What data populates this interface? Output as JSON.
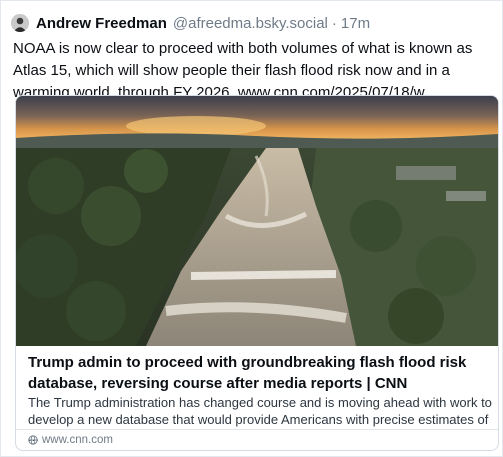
{
  "post": {
    "author_name": "Andrew Freedman",
    "handle": "@afreedma.bsky.social",
    "separator": "·",
    "time_ago": "17m",
    "avatar_icon": "avatar-photo",
    "text": "NOAA is now clear to proceed with both volumes of what is known as Atlas 15, which will show people their flash flood risk now and in a warming world, through FY 2026. www.cnn.com/2025/07/18/w..."
  },
  "link_card": {
    "image_icon": "flooded-river-aerial-photo",
    "title": "Trump admin to proceed with groundbreaking flash flood risk database, reversing course after media reports | CNN",
    "description": "The Trump administration has changed course and is moving ahead with work to develop a new database that would provide Americans with precise estimates of ...",
    "domain_icon": "globe-icon",
    "domain": "www.cnn.com"
  }
}
